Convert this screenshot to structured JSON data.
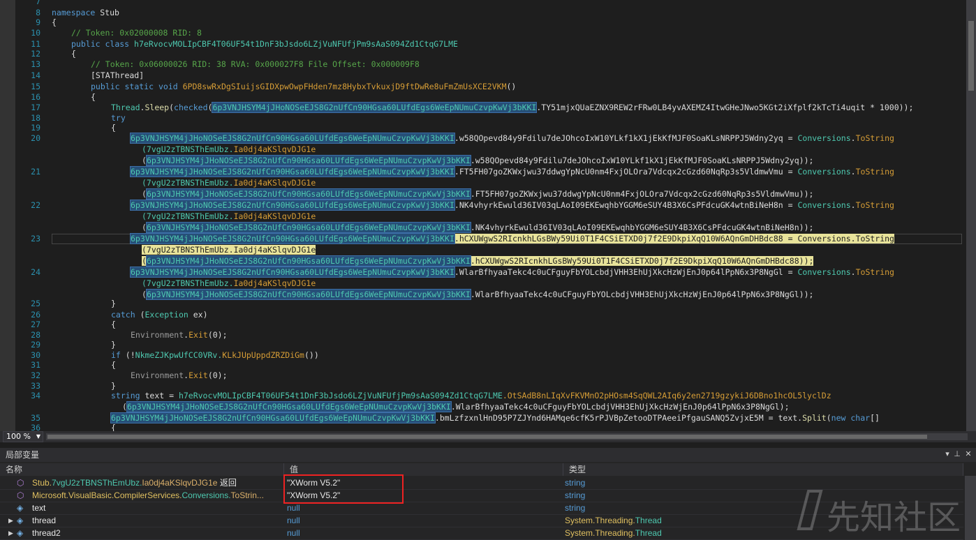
{
  "editor": {
    "lines": [
      {
        "num": "7"
      },
      {
        "num": "8"
      },
      {
        "num": "9"
      },
      {
        "num": "10"
      },
      {
        "num": "11"
      },
      {
        "num": "12"
      },
      {
        "num": "13"
      },
      {
        "num": "14"
      },
      {
        "num": "15"
      },
      {
        "num": "16"
      },
      {
        "num": "17"
      },
      {
        "num": "18"
      },
      {
        "num": "19"
      },
      {
        "num": "20"
      },
      {
        "num": "21"
      },
      {
        "num": "22"
      },
      {
        "num": "23"
      },
      {
        "num": "24"
      },
      {
        "num": "25"
      },
      {
        "num": "26"
      },
      {
        "num": "27"
      },
      {
        "num": "28"
      },
      {
        "num": "29"
      },
      {
        "num": "30"
      },
      {
        "num": "31"
      },
      {
        "num": "32"
      },
      {
        "num": "33"
      },
      {
        "num": "34"
      },
      {
        "num": "35"
      },
      {
        "num": "36"
      }
    ],
    "t": {
      "namespace": "namespace",
      "stub": "Stub",
      "brace_open": "{",
      "brace_close": "}",
      "tok1": "// Token: 0x02000008 RID: 8",
      "public": "public",
      "class": "class",
      "classname": "h7eRvocvMOLIpCBF4T06UF54t1DnF3bJsdo6LZjVuNFUfjPm9sAaS094Zd1CtqG7LME",
      "tok2": "// Token: 0x06000026 RID: 38 RVA: 0x000027F8 File Offset: 0x000009F8",
      "stathread": "[STAThread]",
      "static": "static",
      "void": "void",
      "mainname": "6PD8swRxDgSIuijsGIDXpwOwpFHden7mz8HybxTvkuxjD9ftDwRe8uFmZmUsXCE2VKM",
      "parens": "()",
      "thread": "Thread",
      "sleep": "Sleep",
      "checked": "checked",
      "settings": "6p3VNJHSYM4jJHoNOSeEJS8G2nUfCn90HGsa60LUfdEgs6WeEpNUmuCzvpKwVj3bKKI",
      "sleepval": ".TY51mjxQUaEZNX9REW2rFRw0LB4yvAXEMZ4ItwGHeJNwo5KGt2iXfplf2kTcTi4uqit * 1000));",
      "try": "try",
      "catch": "catch",
      "exception": "Exception",
      "ex": " ex)",
      "f1": ".w58QOpevd84y9Fdilu7deJOhcoIxW10YLkf1kX1jEkKfMJF0SoaKLsNRPPJ5Wdny2yq",
      "f2": ".FT5FH07goZKWxjwu37ddwgYpNcU0nm4FxjOLOra7Vdcqx2cGzd60NqRp3s5VldmwVmu",
      "f3": ".NK4vhyrkEwuld36IV03qLAoI09EKEwqhbYGGM6eSUY4B3X6CsPFdcuGK4wtnBiNeH8n",
      "f4": ".hCXUWgwS2RIcnkhLGsBWy59Ui0T1F4CSiETXD0j7f2E9DkpiXqQ10W6AQnGmDHBdc88",
      "f5": ".WlarBfhyaaTekc4c0uCFguyFbYOLcbdjVHH3EhUjXkcHzWjEnJ0p64lPpN6x3P8NgGl",
      "eqconv": " = ",
      "conversions": "Conversions",
      "tostring": "ToString",
      "decclass": "(7vgU2zTBNSThEmUbz.",
      "decmeth": "Ia0dj4aKSlqvDJG1e",
      "envexit": "Environment",
      "exit": "Exit",
      "zero": "(0);",
      "if": "if",
      "not": " (!",
      "antiname": "NkmeZJKpwUfCC0VRv.",
      "antimeth": "KLkJUpUppdZRZDiGm",
      "call": "())",
      "string": "string",
      "textvar": " text = ",
      "decm2": ".OtSAdB8nLIqXvFKVMnO2pHOsm4SqQWL2AIq6y2en2719gzykiJ6DBno1hcOL5lyclDz",
      "line35tail": ".bmLzfzxnlHnD95P7ZJYnd6HAMqe6cfK5rPJVBpZetooDTPAeeiPfgauSANQ5ZvjxE5M = text.",
      "split": "Split",
      "new": "new",
      "char": "char",
      "bracket": "[]",
      "close2": "));",
      "close1": ");",
      "dot": ".",
      "paren": "(",
      "parenclose": ")"
    }
  },
  "statusbar": {
    "zoom": "100 %"
  },
  "locals": {
    "title": "局部变量",
    "columns": {
      "name": "名称",
      "value": "值",
      "type": "类型"
    },
    "rows": [
      {
        "ns": "Stub.",
        "cls": "7vgU2zTBNSThEmUbz.",
        "member": "Ia0dj4aKSlqvDJG1e",
        "suffix": " 返回",
        "value": "\"XWorm V5.2\"",
        "type": "string"
      },
      {
        "ns": "Microsoft.VisualBasic.CompilerServices.",
        "cls": "Conversions.",
        "member": "ToStrin...",
        "suffix": "",
        "value": "\"XWorm V5.2\"",
        "type": "string"
      },
      {
        "name": "text",
        "value": "null",
        "type": "string"
      },
      {
        "name": "thread",
        "value": "null",
        "type_ns": "System.Threading.",
        "type_cls": "Thread"
      },
      {
        "name": "thread2",
        "value": "null",
        "type_ns": "System.Threading.",
        "type_cls": "Thread"
      }
    ]
  },
  "watermark": {
    "text": "先知社区"
  },
  "colors": {
    "highlight": "#264f78",
    "annotation": "#e22222",
    "background": "#1e1e1e"
  }
}
